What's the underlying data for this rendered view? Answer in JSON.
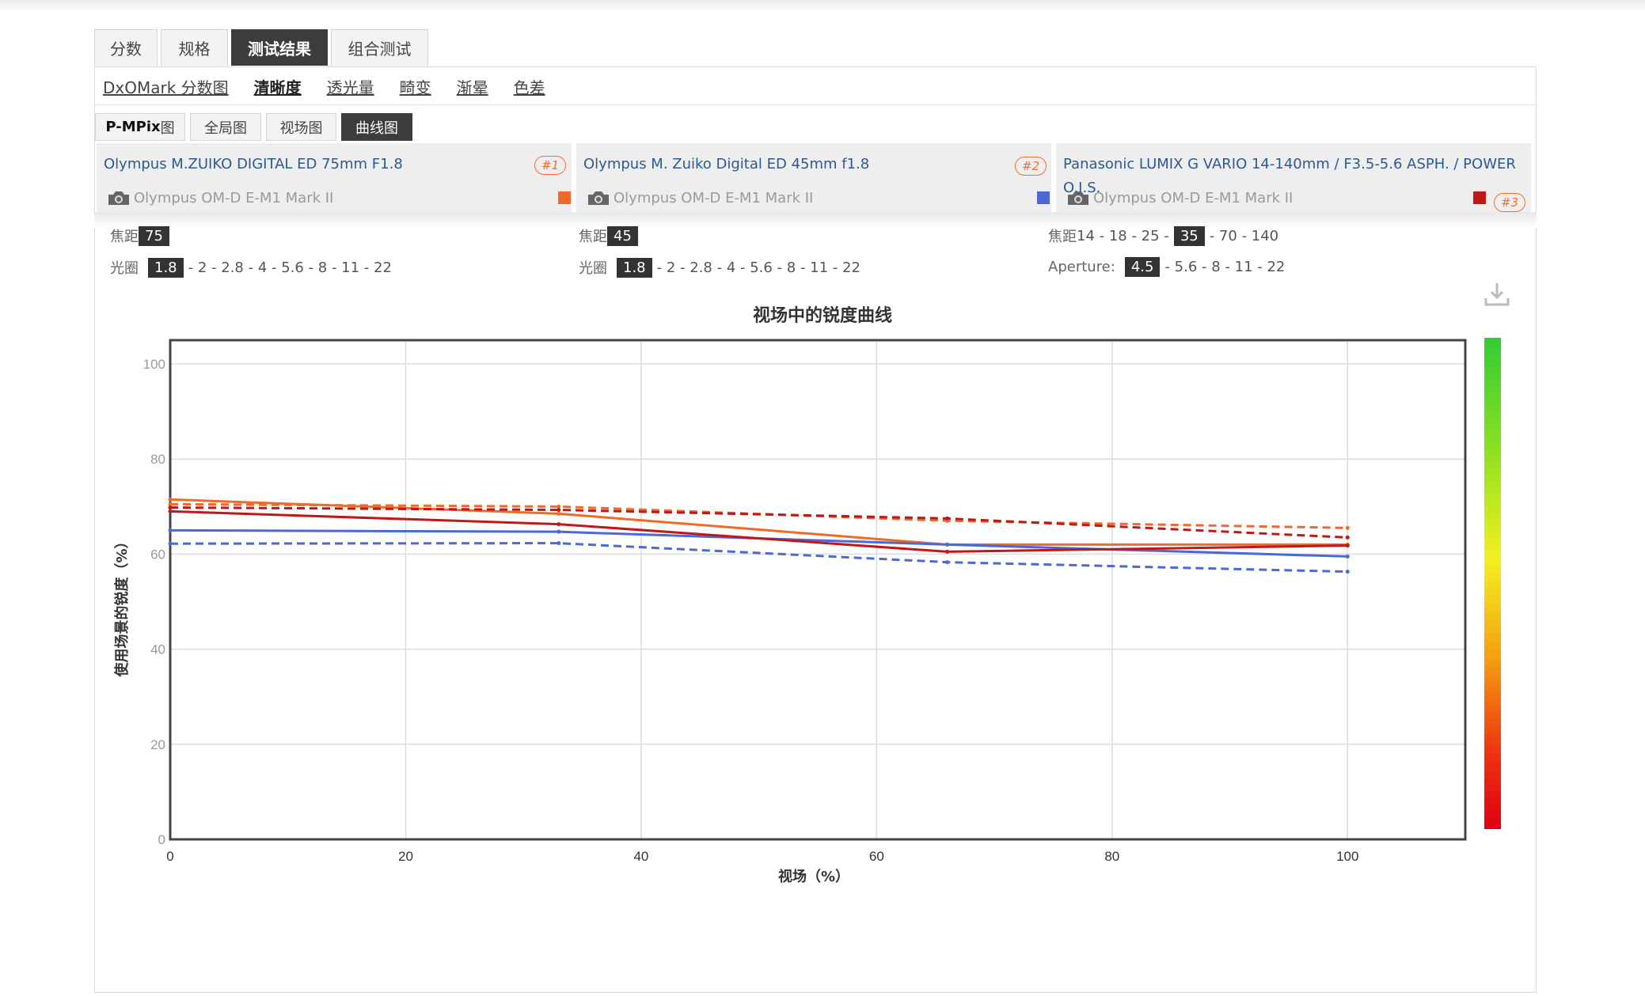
{
  "tabs": [
    "分数",
    "规格",
    "测试结果",
    "组合测试"
  ],
  "subnav": [
    "DxOMark 分数图",
    "清晰度",
    "透光量",
    "畸变",
    "渐晕",
    "色差"
  ],
  "viewtabs": {
    "pmpix": {
      "bold": "P-MPix",
      "rest": "图"
    },
    "global": "全局图",
    "field": "视场图",
    "curve": "曲线图"
  },
  "lenses": [
    {
      "name": "Olympus M.ZUIKO DIGITAL ED 75mm F1.8",
      "camera": "Olympus OM-D E-M1 Mark II",
      "rank": "#1",
      "color": "#f06a28",
      "focal_label": "焦距",
      "focal_options": [
        "75"
      ],
      "focal_selected": "75",
      "aperture_label": "光圈",
      "aperture_selected": "1.8",
      "aperture_rest": "- 2 - 2.8 - 4 - 5.6 - 8 - 11 - 22"
    },
    {
      "name": "Olympus M. Zuiko Digital ED 45mm f1.8",
      "camera": "Olympus OM-D E-M1 Mark II",
      "rank": "#2",
      "color": "#4a68d8",
      "focal_label": "焦距",
      "focal_selected": "45",
      "aperture_label": "光圈",
      "aperture_selected": "1.8",
      "aperture_rest": "- 2 - 2.8 - 4 - 5.6 - 8 - 11 - 22"
    },
    {
      "name": "Panasonic LUMIX G VARIO 14-140mm / F3.5-5.6 ASPH. / POWER O.I.S.",
      "camera": "Olympus OM-D E-M1 Mark II",
      "rank": "#3",
      "color": "#c01818",
      "focal_label": "焦距",
      "focal_before": "14 - 18 - 25 -",
      "focal_selected": "35",
      "focal_after": "- 70 - 140",
      "aperture_label": "Aperture:",
      "aperture_selected": "4.5",
      "aperture_rest": "- 5.6 - 8 - 11 - 22"
    }
  ],
  "download_icon": "download-icon",
  "chart_data": {
    "type": "line",
    "title": "视场中的锐度曲线",
    "xlabel": "视场（%）",
    "ylabel": "使用场景的锐度（%）",
    "xlim": [
      0,
      110
    ],
    "ylim": [
      0,
      105
    ],
    "xticks": [
      0,
      20,
      40,
      60,
      80,
      100
    ],
    "yticks": [
      0,
      20,
      40,
      60,
      80,
      100
    ],
    "grid": true,
    "colorbar": "green-to-red vertical scale on the right",
    "series": [
      {
        "lens": 1,
        "style": "solid",
        "color": "#f06a28",
        "x": [
          0,
          33,
          66,
          100
        ],
        "y": [
          71.5,
          68.5,
          62,
          62
        ]
      },
      {
        "lens": 1,
        "style": "dashed",
        "color": "#f06a28",
        "x": [
          0,
          33,
          66,
          100
        ],
        "y": [
          70.5,
          70,
          67,
          65.5
        ]
      },
      {
        "lens": 2,
        "style": "solid",
        "color": "#4a68d8",
        "x": [
          0,
          33,
          66,
          100
        ],
        "y": [
          65,
          64.7,
          62,
          59.5
        ]
      },
      {
        "lens": 2,
        "style": "dashed",
        "color": "#4a68d8",
        "x": [
          0,
          33,
          66,
          100
        ],
        "y": [
          62.2,
          62.3,
          58.3,
          56.3
        ]
      },
      {
        "lens": 3,
        "style": "solid",
        "color": "#c01818",
        "x": [
          0,
          33,
          66,
          100
        ],
        "y": [
          69,
          66.3,
          60.5,
          61.8
        ]
      },
      {
        "lens": 3,
        "style": "dashed",
        "color": "#c01818",
        "x": [
          0,
          33,
          66,
          100
        ],
        "y": [
          69.8,
          69.3,
          67.5,
          63.5
        ]
      }
    ]
  }
}
